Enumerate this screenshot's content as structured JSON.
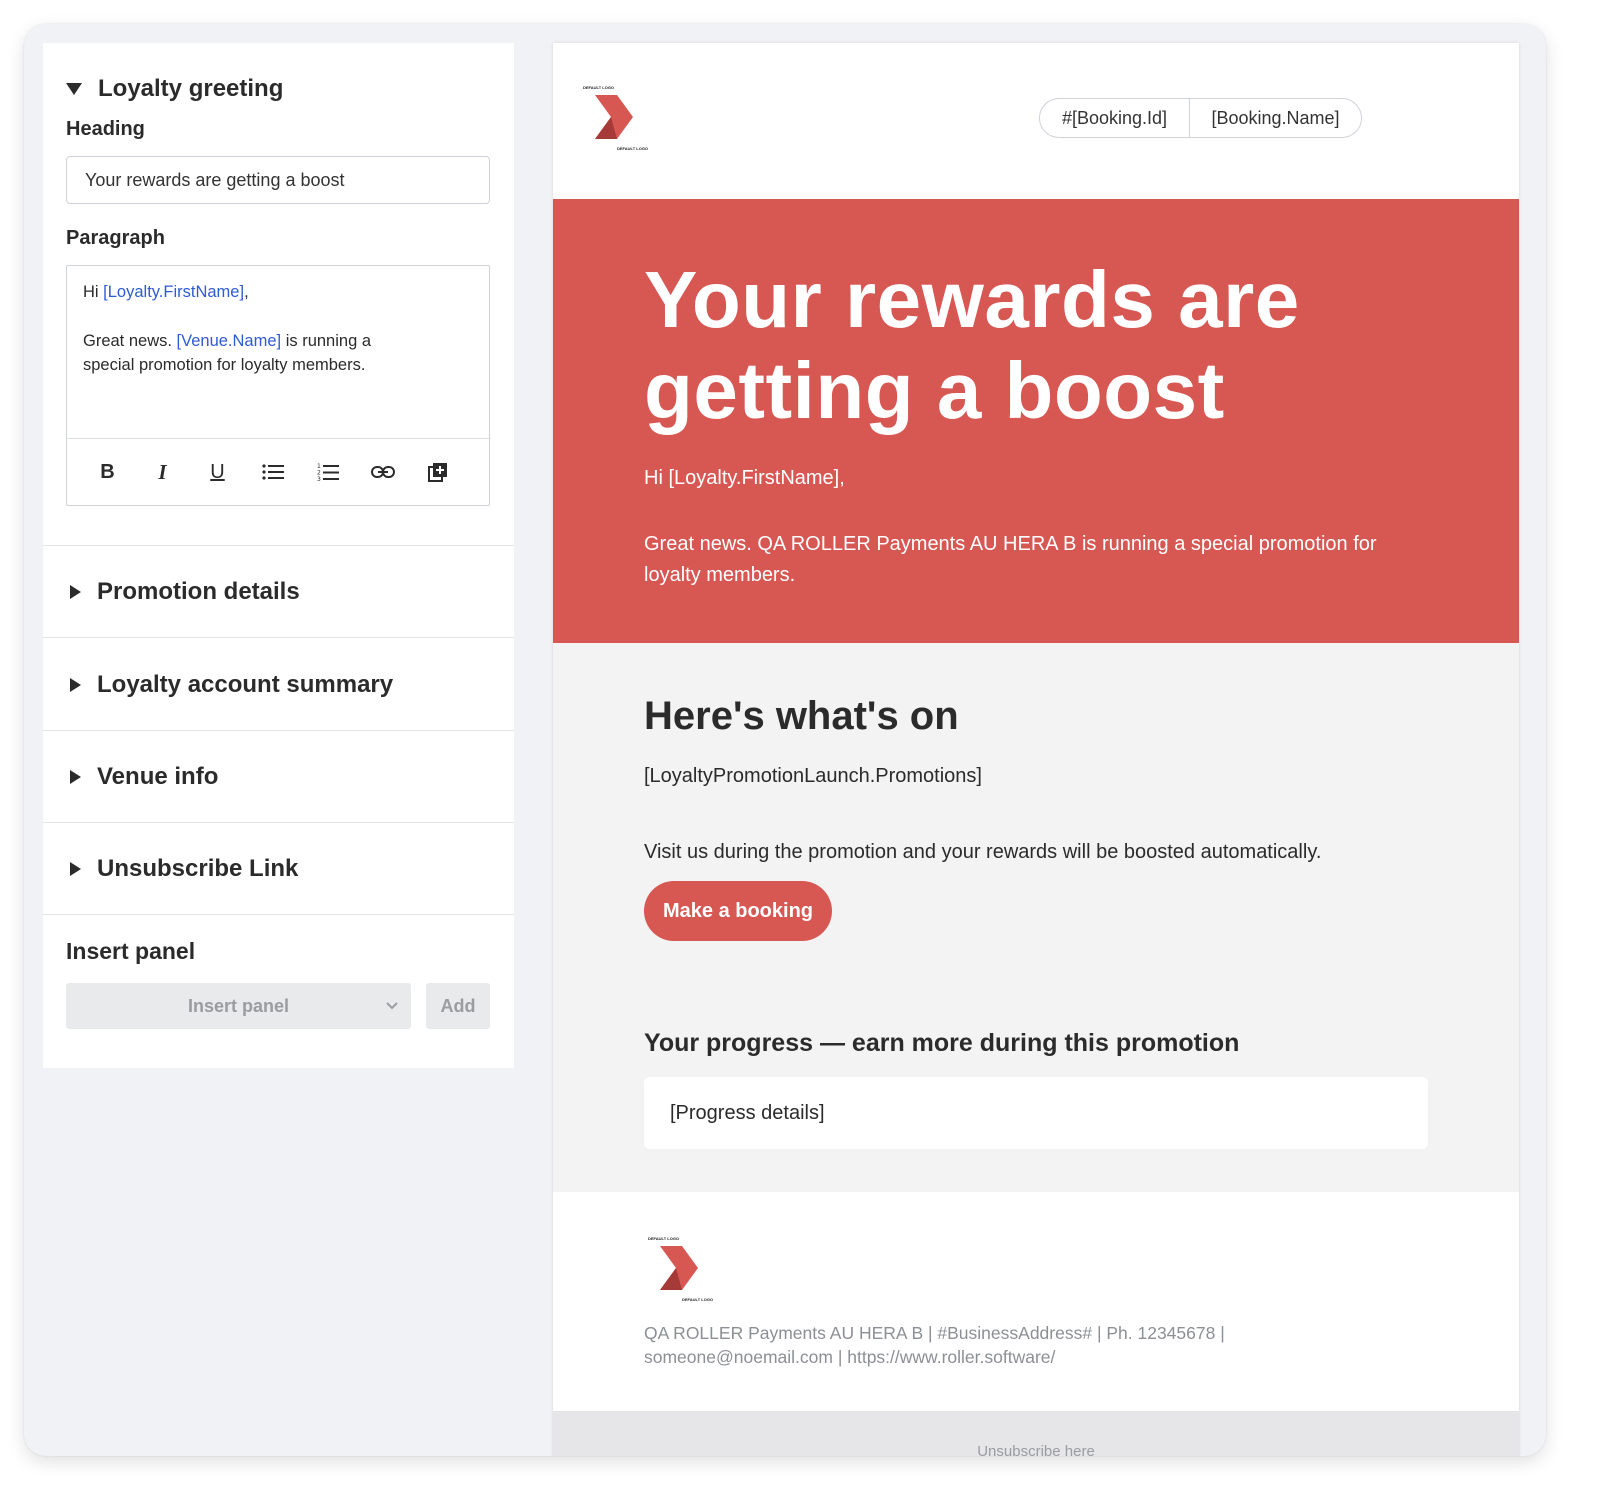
{
  "editor": {
    "greeting": {
      "title": "Loyalty greeting",
      "heading_label": "Heading",
      "heading_value": "Your rewards are getting a boost",
      "paragraph_label": "Paragraph",
      "paragraph": {
        "hi_prefix": "Hi ",
        "hi_token": "[Loyalty.FirstName]",
        "hi_suffix": ",",
        "news_prefix": "Great news. ",
        "news_token": "[Venue.Name]",
        "news_suffix": " is running a special promotion for loyalty members."
      },
      "toolbar": [
        "bold",
        "italic",
        "underline",
        "bulleted-list",
        "numbered-list",
        "link",
        "insert-token"
      ]
    },
    "sections": [
      {
        "title": "Promotion details"
      },
      {
        "title": "Loyalty account summary"
      },
      {
        "title": "Venue info"
      },
      {
        "title": "Unsubscribe Link"
      }
    ],
    "insert": {
      "label": "Insert panel",
      "select_value": "Insert panel",
      "add_label": "Add"
    }
  },
  "preview": {
    "logo_text": "DEFAULT LOGO",
    "pill": {
      "booking_id": "#[Booking.Id]",
      "booking_name": "[Booking.Name]"
    },
    "hero": {
      "heading": "Your rewards are getting a boost",
      "hi": "Hi [Loyalty.FirstName],",
      "news": "Great news. QA ROLLER Payments AU HERA B is running a special promotion for loyalty members."
    },
    "whats_on": "Here's what's on",
    "promotions_token": "[LoyaltyPromotionLaunch.Promotions]",
    "visit_text": "Visit us during the promotion and your rewards will be boosted automatically.",
    "cta_label": "Make a booking",
    "progress_title": "Your progress — earn more during this promotion",
    "progress_details": "[Progress details]",
    "footer_text": "QA ROLLER Payments AU HERA B | #BusinessAddress# | Ph. 12345678 | someone@noemail.com | https://www.roller.software/",
    "unsubscribe": "Unsubscribe here"
  },
  "colors": {
    "brand_red": "#d75753",
    "token_blue": "#2f5bd3",
    "background": "#f1f2f6"
  }
}
